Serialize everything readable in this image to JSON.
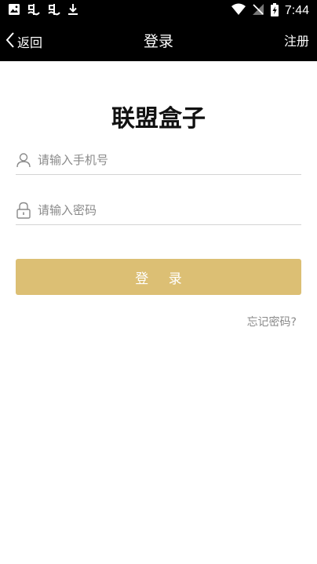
{
  "status_bar": {
    "time": "7:44",
    "left_icons": [
      "image-icon",
      "app-icon",
      "app-icon",
      "download-icon"
    ],
    "right_icons": [
      "wifi-icon",
      "no-signal-icon",
      "battery-charging-icon"
    ]
  },
  "nav": {
    "back_label": "返回",
    "title": "登录",
    "register_label": "注册"
  },
  "app_title": "联盟盒子",
  "form": {
    "phone_placeholder": "请输入手机号",
    "password_placeholder": "请输入密码",
    "login_label": "登 录",
    "forgot_label": "忘记密码?"
  },
  "colors": {
    "bar_bg": "#000000",
    "accent": "#dcbf74",
    "placeholder": "#8a8a8a"
  }
}
